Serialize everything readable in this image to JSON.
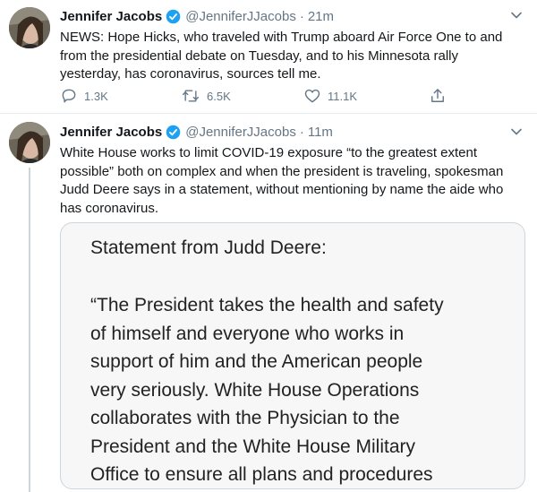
{
  "tweets": [
    {
      "author_name": "Jennifer Jacobs",
      "handle": "@JenniferJJacobs",
      "separator": "·",
      "time": "21m",
      "text": "NEWS: Hope Hicks, who traveled with Trump aboard Air Force One to and\nfrom the presidential debate on Tuesday, and to his Minnesota rally\nyesterday, has coronavirus, sources tell me.",
      "replies": "1.3K",
      "retweets": "6.5K",
      "likes": "11.1K"
    },
    {
      "author_name": "Jennifer Jacobs",
      "handle": "@JenniferJJacobs",
      "separator": "·",
      "time": "11m",
      "text": "White House works to limit COVID-19 exposure “to the greatest extent\npossible” both on complex and when the president is traveling, spokesman\nJudd Deere says in a statement, without mentioning by name the aide who\nhas coronavirus.",
      "statement_image": {
        "title": "Statement from Judd Deere:",
        "body": "“The President takes the health and safety\nof himself and everyone who works in\nsupport of him and the American people\nvery seriously. White House Operations\ncollaborates with the Physician to the\nPresident and the White House Military\nOffice to ensure all plans and procedures"
      }
    }
  ],
  "colors": {
    "verified_badge": "#1da1f2",
    "secondary_text": "#657786",
    "thread_line": "#ccd6dd",
    "divider": "#e6ecf0"
  },
  "icons": [
    "verified-badge-icon",
    "chevron-down-icon",
    "reply-icon",
    "retweet-icon",
    "like-icon",
    "share-icon"
  ]
}
